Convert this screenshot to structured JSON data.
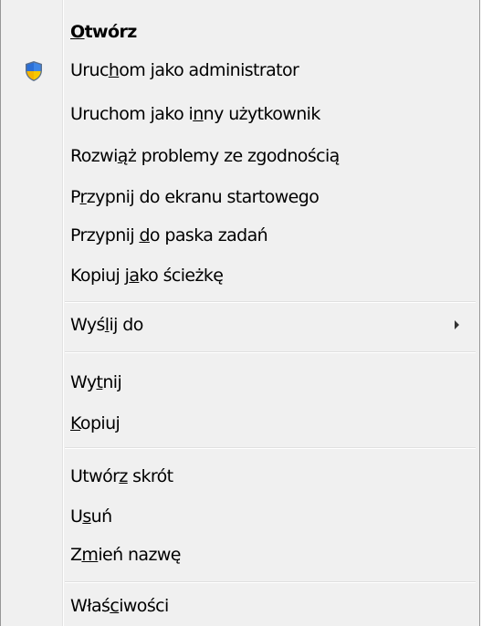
{
  "menu": {
    "open": {
      "pre": "",
      "acc": "O",
      "post": "twórz"
    },
    "run_as_admin": {
      "pre": "Uruc",
      "acc": "h",
      "post": "om jako administrator"
    },
    "run_as_other": {
      "pre": "Uruchom jako i",
      "acc": "n",
      "post": "ny użytkownik"
    },
    "troubleshoot": {
      "pre": "Rozwi",
      "acc": "ą",
      "post": "ż problemy ze zgodnością"
    },
    "pin_start": {
      "pre": "P",
      "acc": "r",
      "post": "zypnij do ekranu startowego"
    },
    "pin_taskbar": {
      "pre": "Przypnij ",
      "acc": "d",
      "post": "o paska zadań"
    },
    "copy_path": {
      "pre": "Kopiuj j",
      "acc": "a",
      "post": "ko ścieżkę"
    },
    "send_to": {
      "pre": "Wyś",
      "acc": "l",
      "post": "ij do"
    },
    "cut": {
      "pre": "Wy",
      "acc": "t",
      "post": "nij"
    },
    "copy": {
      "pre": "",
      "acc": "K",
      "post": "opiuj"
    },
    "create_shortcut": {
      "pre": "Utwór",
      "acc": "z",
      "post": " skrót"
    },
    "delete": {
      "pre": "U",
      "acc": "s",
      "post": "uń"
    },
    "rename": {
      "pre": "Z",
      "acc": "m",
      "post": "ień nazwę"
    },
    "properties": {
      "pre": "Właś",
      "acc": "c",
      "post": "iwości"
    }
  },
  "icons": {
    "admin": "uac-shield-icon",
    "submenu": "submenu-arrow-icon"
  },
  "colors": {
    "menu_bg": "#f0f0f0",
    "border": "#979797",
    "shield_blue": "#2b6fd6",
    "shield_yellow": "#f6c800"
  }
}
